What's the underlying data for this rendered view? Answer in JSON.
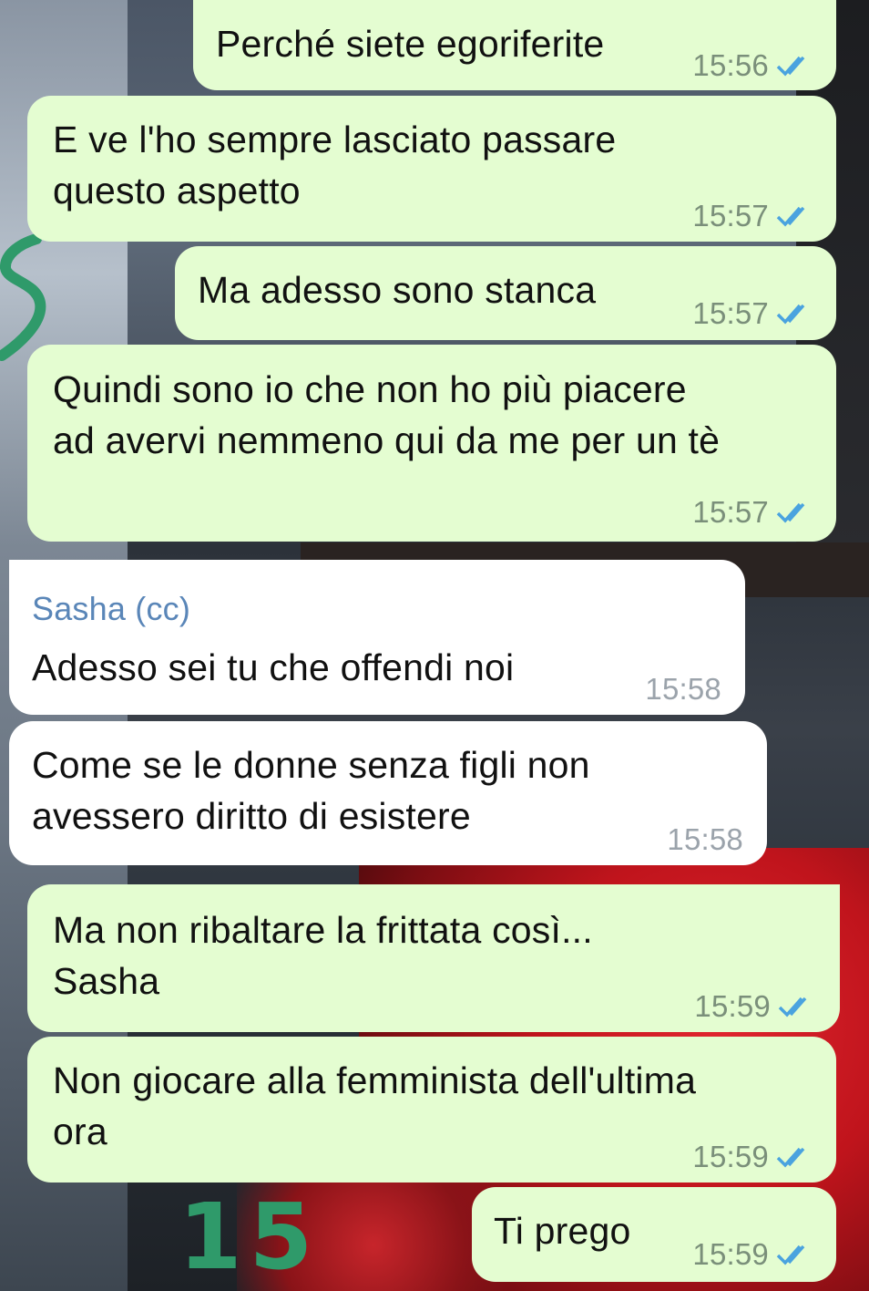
{
  "messages": [
    {
      "id": "m1",
      "direction": "out",
      "text": "Perché siete egoriferite",
      "time": "15:56",
      "status": "read"
    },
    {
      "id": "m2",
      "direction": "out",
      "text": "E ve l'ho sempre lasciato passare\nquesto aspetto",
      "time": "15:57",
      "status": "read"
    },
    {
      "id": "m3",
      "direction": "out",
      "text": "Ma adesso sono stanca",
      "time": "15:57",
      "status": "read"
    },
    {
      "id": "m4",
      "direction": "out",
      "text": "Quindi sono io che non ho più piacere\nad avervi nemmeno qui da me per un tè",
      "time": "15:57",
      "status": "read"
    },
    {
      "id": "m5",
      "direction": "in",
      "sender": "Sasha (cc)",
      "text": "Adesso sei tu che offendi noi",
      "time": "15:58"
    },
    {
      "id": "m6",
      "direction": "in",
      "text": "Come se le donne senza figli non\navessero diritto di esistere",
      "time": "15:58"
    },
    {
      "id": "m7",
      "direction": "out",
      "text": "Ma non ribaltare la frittata così...\nSasha",
      "time": "15:59",
      "status": "read"
    },
    {
      "id": "m8",
      "direction": "out",
      "text": "Non giocare alla femminista dell'ultima\nora",
      "time": "15:59",
      "status": "read"
    },
    {
      "id": "m9",
      "direction": "out",
      "text": "Ti prego",
      "time": "15:59",
      "status": "read"
    }
  ],
  "annotations": {
    "page_number": "15",
    "color": "#2f9a6a"
  },
  "colors": {
    "outgoing_bubble": "#e4fdd1",
    "incoming_bubble": "#ffffff",
    "read_ticks": "#4aa3df",
    "sender_name": "#5a86b8"
  },
  "icons": {
    "read_status": "double-check-icon"
  }
}
